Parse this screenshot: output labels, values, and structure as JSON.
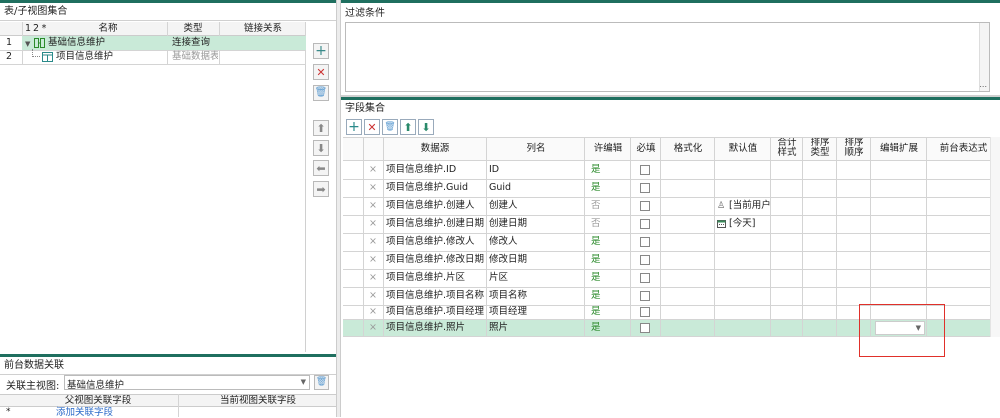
{
  "left_panel": {
    "title": "表/子视图集合",
    "header": {
      "col_idx1": "1",
      "col_idx2": "2",
      "col_star": "*",
      "col_name": "名称",
      "col_type": "类型",
      "col_link": "链接关系"
    },
    "rows": [
      {
        "num": "1",
        "name": "基础信息维护",
        "type": "连接查询"
      },
      {
        "num": "2",
        "name": "项目信息维护",
        "type": "基础数据表"
      }
    ]
  },
  "filter_panel": {
    "title": "过滤条件",
    "ellipsis": "..."
  },
  "fields_panel": {
    "title": "字段集合",
    "headers": {
      "source": "数据源",
      "column": "列名",
      "editable": "许编辑",
      "required": "必填",
      "format": "格式化",
      "default": "默认值",
      "total1": "合计",
      "total2": "样式",
      "sort1a": "排序",
      "sort1b": "类型",
      "sort2a": "排序",
      "sort2b": "顺序",
      "edit_ext": "编辑扩展",
      "front_expr": "前台表达式"
    },
    "rows": [
      {
        "source": "项目信息维护.ID",
        "column": "ID",
        "editable": "是",
        "editable_gray": false,
        "default": ""
      },
      {
        "source": "项目信息维护.Guid",
        "column": "Guid",
        "editable": "是",
        "editable_gray": false,
        "default": ""
      },
      {
        "source": "项目信息维护.创建人",
        "column": "创建人",
        "editable": "否",
        "editable_gray": true,
        "default": "[当前用户"
      },
      {
        "source": "项目信息维护.创建日期",
        "column": "创建日期",
        "editable": "否",
        "editable_gray": true,
        "default": "[今天]"
      },
      {
        "source": "项目信息维护.修改人",
        "column": "修改人",
        "editable": "是",
        "editable_gray": false,
        "default": ""
      },
      {
        "source": "项目信息维护.修改日期",
        "column": "修改日期",
        "editable": "是",
        "editable_gray": false,
        "default": ""
      },
      {
        "source": "项目信息维护.片区",
        "column": "片区",
        "editable": "是",
        "editable_gray": false,
        "default": ""
      },
      {
        "source": "项目信息维护.项目名称",
        "column": "项目名称",
        "editable": "是",
        "editable_gray": false,
        "default": ""
      },
      {
        "source": "项目信息维护.项目经理",
        "column": "项目经理",
        "editable": "是",
        "editable_gray": false,
        "default": ""
      },
      {
        "source": "项目信息维护.照片",
        "column": "照片",
        "editable": "是",
        "editable_gray": false,
        "default": ""
      }
    ]
  },
  "relation_panel": {
    "title": "前台数据关联",
    "main_view_label": "关联主视图:",
    "main_view_value": "基础信息维护",
    "col_parent": "父视图关联字段",
    "col_current": "当前视图关联字段",
    "add_link": "添加关联字段",
    "star": "*"
  },
  "colors": {
    "accent": "#1f6f5f",
    "selected_row": "#c9ead8",
    "highlight_box": "#e0302a"
  }
}
